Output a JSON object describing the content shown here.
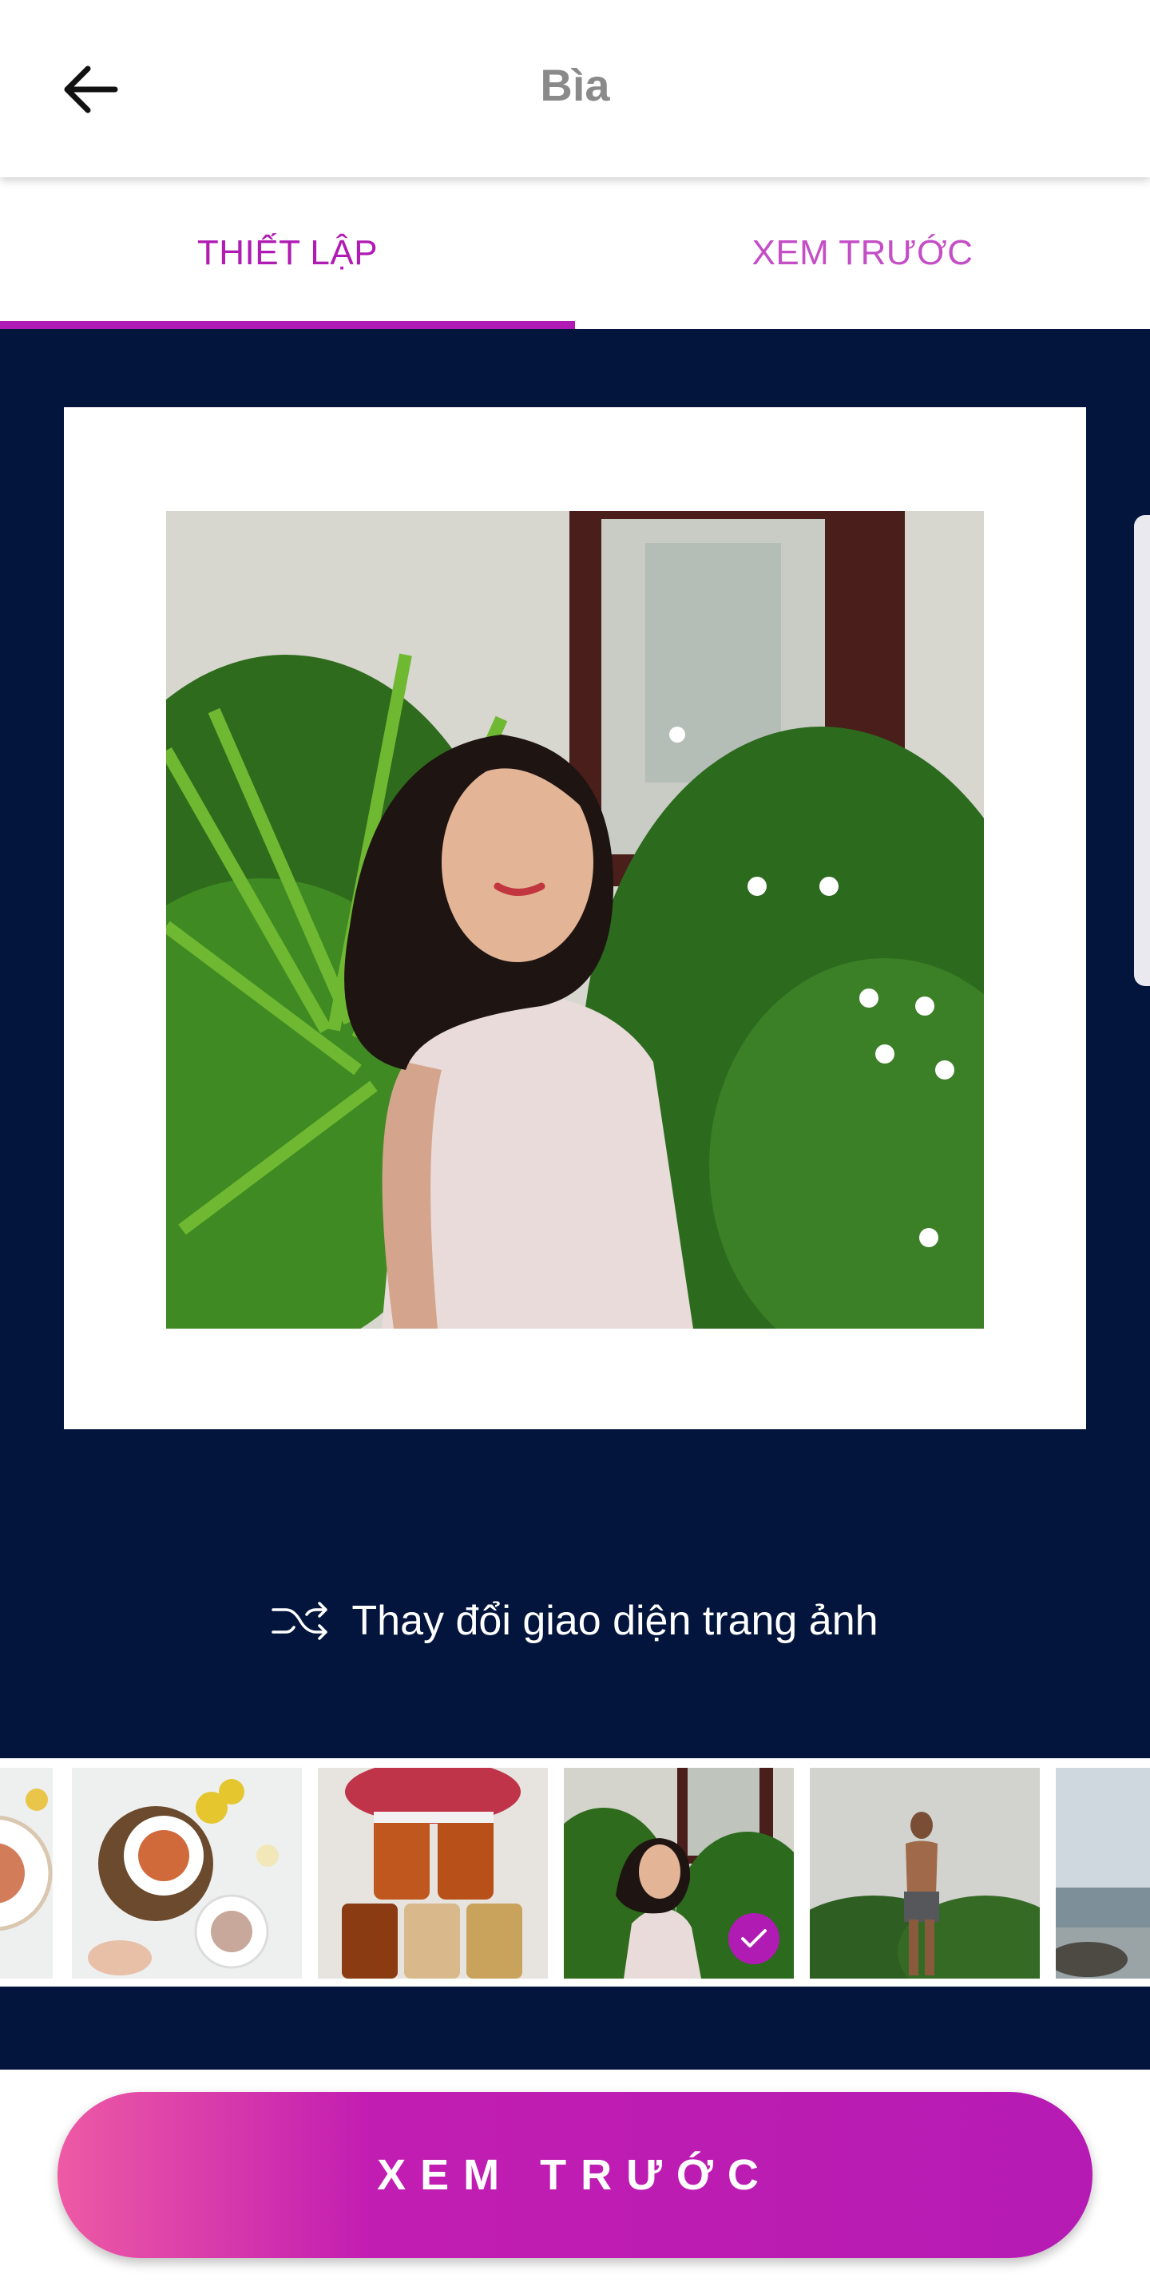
{
  "header": {
    "title": "Bìa",
    "back_icon": "arrow-left-icon"
  },
  "tabs": [
    {
      "label": "THIẾT LẬP",
      "active": true
    },
    {
      "label": "XEM TRƯỚC",
      "active": false
    }
  ],
  "editor": {
    "shuffle_icon": "shuffle-icon",
    "shuffle_label": "Thay đổi giao diện trang ảnh"
  },
  "thumbnails": [
    {
      "subject": "food-plate-partial",
      "selected": false
    },
    {
      "subject": "food-plates-flowers",
      "selected": false
    },
    {
      "subject": "jars-with-flowers",
      "selected": false
    },
    {
      "subject": "woman-with-plants",
      "selected": true
    },
    {
      "subject": "man-in-garden",
      "selected": false
    },
    {
      "subject": "beach-partial",
      "selected": false
    }
  ],
  "footer": {
    "preview_button_label": "XEM TRƯỚC"
  },
  "colors": {
    "accent": "#b01bb3",
    "dark_background": "#03153c",
    "title_gray": "#8a8a8a",
    "gradient_start": "#ee5aa4"
  }
}
